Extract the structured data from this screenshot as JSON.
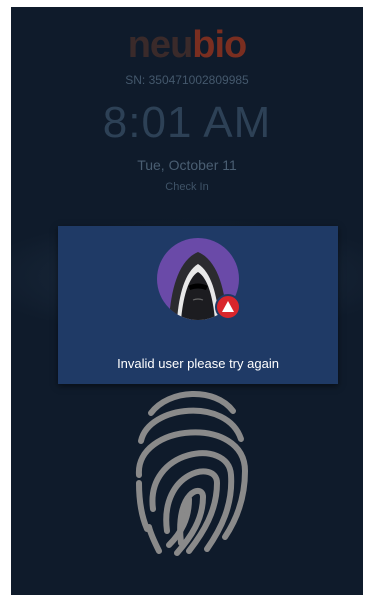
{
  "brand": {
    "logo_part1": "neu",
    "logo_part2": "bio"
  },
  "device": {
    "serial": "SN: 350471002809985"
  },
  "clock": {
    "time": "8:01 AM",
    "date": "Tue, October 11",
    "mode": "Check In"
  },
  "dialog": {
    "message": "Invalid user please try again",
    "avatar_icon": "hooded-user-icon",
    "badge_icon": "warning-icon"
  },
  "scanner": {
    "icon": "fingerprint-icon"
  },
  "colors": {
    "screen_bg": "#0f1b2b",
    "dialog_bg": "#1f3a66",
    "avatar_bg": "#6a4aa8",
    "alert": "#d9262c",
    "logo_accent": "#7a2e20"
  }
}
